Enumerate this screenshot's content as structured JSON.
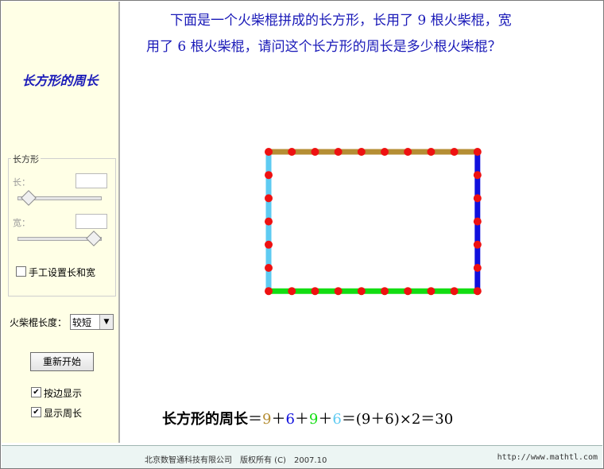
{
  "sidebar": {
    "title": "长方形的周长",
    "group_label": "长方形",
    "length_label": "长：",
    "width_label": "宽：",
    "length_slider_value": 0.13,
    "width_slider_value": 0.92,
    "manual_checkbox": {
      "label": "手工设置长和宽",
      "checked": false
    },
    "match_length_label": "火柴棍长度：",
    "match_length_select": "较短",
    "restart_button": "重新开始",
    "show_by_side": {
      "label": "按边显示",
      "checked": true
    },
    "show_perimeter": {
      "label": "显示周长",
      "checked": true
    }
  },
  "question": {
    "line1": "下面是一个火柴棍拼成的长方形，长用了 9 根火柴棍，宽",
    "line2": "用了 6 根火柴棍，请问这个长方形的周长是多少根火柴棍？"
  },
  "rectangle": {
    "length_sticks": 9,
    "width_sticks": 6,
    "colors": {
      "top": "#b58e34",
      "right": "#1010dd",
      "bottom": "#12dd12",
      "left": "#5ecbf2",
      "dot": "#ee1111"
    }
  },
  "formula": {
    "title": "长方形的周长",
    "eq1": "＝",
    "a": "9",
    "plus": "＋",
    "b": "6",
    "c": "9",
    "d": "6",
    "rest": "＝(9＋6)×2＝30",
    "color_a": "#b58e34",
    "color_b": "#1010dd",
    "color_c": "#12dd12",
    "color_d": "#5ecbf2"
  },
  "footer": {
    "copyright": "北京数智通科技有限公司　版权所有 (C)　2007.10",
    "url": "http://www.mathtl.com"
  }
}
